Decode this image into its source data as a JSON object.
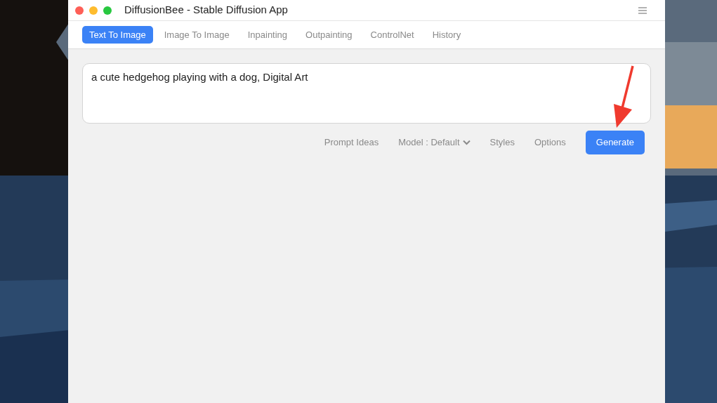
{
  "window": {
    "title": "DiffusionBee - Stable Diffusion App"
  },
  "tabs": [
    {
      "label": "Text To Image",
      "selected": true
    },
    {
      "label": "Image To Image",
      "selected": false
    },
    {
      "label": "Inpainting",
      "selected": false
    },
    {
      "label": "Outpainting",
      "selected": false
    },
    {
      "label": "ControlNet",
      "selected": false
    },
    {
      "label": "History",
      "selected": false
    }
  ],
  "prompt": {
    "value": "a cute hedgehog playing with a dog, Digital Art"
  },
  "toolbar": [
    {
      "kind": "link",
      "label": "Prompt Ideas"
    },
    {
      "kind": "dropdown",
      "label": "Model : Default"
    },
    {
      "kind": "link",
      "label": "Styles"
    },
    {
      "kind": "link",
      "label": "Options"
    },
    {
      "kind": "primary",
      "label": "Generate"
    }
  ]
}
